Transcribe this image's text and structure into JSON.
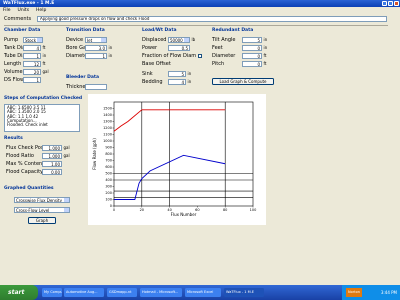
{
  "window": {
    "title": "WaTFlux.exe - 1 M.E"
  },
  "menu": [
    "File",
    "Units",
    "Help"
  ],
  "comments": {
    "label": "Comments",
    "value": "Applying good pressure drops on flow and check Flood"
  },
  "chamber": {
    "title": "Chamber Data",
    "rows": [
      {
        "label": "Pump",
        "value": "Stock",
        "unit": ""
      },
      {
        "label": "Tank Diam",
        "value": "4",
        "unit": "ft"
      },
      {
        "label": "Tube Diam",
        "value": "1",
        "unit": "in"
      },
      {
        "label": "Length",
        "value": "12",
        "unit": "ft"
      },
      {
        "label": "Volume",
        "value": "20",
        "unit": "gal"
      },
      {
        "label": "DS Flows",
        "value": "1",
        "unit": ""
      }
    ]
  },
  "transition": {
    "title": "Transition Data",
    "rows": [
      {
        "label": "Device",
        "value": "Jet",
        "unit": ""
      },
      {
        "label": "Bore Gas",
        "value": "3.0",
        "unit": "in"
      },
      {
        "label": "Diameter",
        "value": "1",
        "unit": "in"
      }
    ]
  },
  "bleeder": {
    "title": "Bleeder Data",
    "rows": [
      {
        "label": "Thickness",
        "value": "",
        "unit": ""
      }
    ]
  },
  "load": {
    "title": "Load/Wt Data",
    "rows": [
      {
        "label": "Displaced",
        "value": "50000",
        "unit": "lb"
      },
      {
        "label": "Power",
        "value": "0.5",
        "unit": ""
      },
      {
        "label": "Fraction of Flow Diam",
        "value": "",
        "unit": ""
      },
      {
        "label": "Base Offset",
        "value": "",
        "unit": ""
      },
      {
        "label": "Sink",
        "value": "5",
        "unit": "in"
      },
      {
        "label": "Bedding",
        "value": "4",
        "unit": "in"
      }
    ]
  },
  "redundant": {
    "title": "Redundant Data",
    "rows": [
      {
        "label": "Tilt Angle",
        "value": "5",
        "unit": "in"
      },
      {
        "label": "Feet",
        "value": "0",
        "unit": "in"
      },
      {
        "label": "Diameter",
        "value": "0",
        "unit": "ft"
      },
      {
        "label": "Pitch",
        "value": "0",
        "unit": "ft"
      }
    ],
    "button": "Load Graph & Compute"
  },
  "steps": {
    "title": "Steps of Computation Checked",
    "lines": [
      "ABC: 1.6500 3.5 11",
      "ABC: 1.3500 2.0 15",
      "ABC: 1.1 1.0 42",
      "Computation...",
      "Flooded. Check inlet"
    ]
  },
  "results": {
    "title": "Results",
    "rows": [
      {
        "label": "Flux Check Poss",
        "value": "1.000",
        "unit": "gal"
      },
      {
        "label": "Flood Ratio",
        "value": "1.000",
        "unit": "gal"
      },
      {
        "label": "Max % Content",
        "value": "1.00",
        "unit": ""
      },
      {
        "label": "Flood Capacity",
        "value": "0.00",
        "unit": ""
      }
    ]
  },
  "graphed": {
    "title": "Graphed Quantities",
    "options": [
      "Crosswise Flux Density",
      "Cross-Flow Level"
    ],
    "button": "Graph"
  },
  "chart_data": {
    "type": "line",
    "xlabel": "Flux Number",
    "ylabel": "Flow Rate (gph)",
    "xlim": [
      0,
      100
    ],
    "ylim": [
      0,
      1600
    ],
    "xticks": [
      0,
      20,
      40,
      60,
      80,
      100
    ],
    "yticks": [
      0,
      100,
      200,
      300,
      400,
      500,
      600,
      700,
      800,
      900,
      1000,
      1100,
      1200,
      1300,
      1400,
      1500
    ],
    "hlines": [
      130,
      230,
      400,
      500
    ],
    "vlines": [
      20,
      40,
      80
    ],
    "series": [
      {
        "color": "#dd0000",
        "x": [
          0,
          5,
          10,
          20,
          40,
          60,
          80
        ],
        "y": [
          1150,
          1230,
          1300,
          1480,
          1480,
          1480,
          1480
        ]
      },
      {
        "color": "#0000cc",
        "x": [
          0,
          15,
          18,
          20,
          26,
          50,
          80
        ],
        "y": [
          100,
          100,
          350,
          420,
          540,
          780,
          650
        ]
      }
    ]
  },
  "taskbar": {
    "start": "start",
    "tasks": [
      "My Computer",
      "Automotive Aug...",
      "GSDmapp-nt",
      "Hotmail - Microsoft...",
      "Microsoft Excel",
      "WaTFlux - 1 M.E"
    ],
    "tray": [
      "Norton",
      "3:44 PM"
    ]
  },
  "colors": {
    "titlebar": "#0b3fb5",
    "workspace": "#ece9d8",
    "series_red": "#dd0000",
    "series_blue": "#0000cc"
  }
}
